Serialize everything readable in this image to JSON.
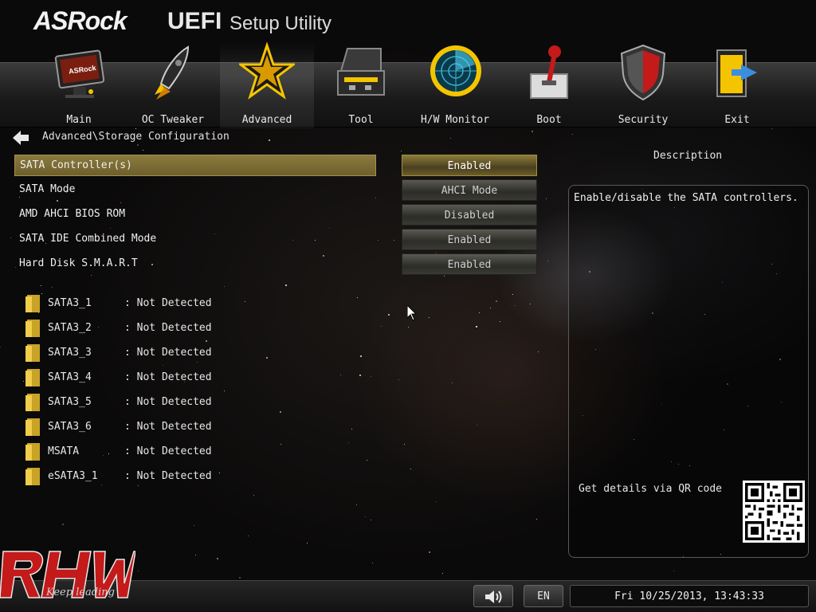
{
  "header": {
    "logo_text": "ASRock",
    "uefi_text": "UEFI",
    "setup_text": "Setup Utility"
  },
  "nav": {
    "active": "Advanced",
    "tabs": [
      {
        "label": "Main",
        "icon": "monitor-icon"
      },
      {
        "label": "OC Tweaker",
        "icon": "rocket-icon"
      },
      {
        "label": "Advanced",
        "icon": "star-icon"
      },
      {
        "label": "Tool",
        "icon": "toolbox-icon"
      },
      {
        "label": "H/W Monitor",
        "icon": "radar-icon"
      },
      {
        "label": "Boot",
        "icon": "joystick-icon"
      },
      {
        "label": "Security",
        "icon": "shield-icon"
      },
      {
        "label": "Exit",
        "icon": "exit-door-icon"
      }
    ]
  },
  "breadcrumb": "Advanced\\Storage Configuration",
  "settings": [
    {
      "label": "SATA Controller(s)",
      "value": "Enabled"
    },
    {
      "label": "SATA Mode",
      "value": "AHCI Mode"
    },
    {
      "label": "AMD AHCI BIOS ROM",
      "value": "Disabled"
    },
    {
      "label": "SATA IDE Combined Mode",
      "value": "Enabled"
    },
    {
      "label": "Hard Disk S.M.A.R.T",
      "value": "Enabled"
    }
  ],
  "drives": [
    {
      "port": "SATA3_1",
      "status": ": Not Detected"
    },
    {
      "port": "SATA3_2",
      "status": ": Not Detected"
    },
    {
      "port": "SATA3_3",
      "status": ": Not Detected"
    },
    {
      "port": "SATA3_4",
      "status": ": Not Detected"
    },
    {
      "port": "SATA3_5",
      "status": ": Not Detected"
    },
    {
      "port": "SATA3_6",
      "status": ": Not Detected"
    },
    {
      "port": "MSATA",
      "status": ": Not Detected"
    },
    {
      "port": "eSATA3_1",
      "status": ": Not Detected"
    }
  ],
  "description": {
    "title": "Description",
    "text": "Enable/disable the SATA controllers.",
    "qr_label": "Get details via QR code"
  },
  "footer": {
    "watermark_logo": "RHW",
    "watermark_tagline": "Keep leading",
    "language": "EN",
    "datetime": "Fri 10/25/2013, 13:43:33"
  },
  "colors": {
    "selected_row": "#7d6e34",
    "accent_gold": "#f5c400",
    "watermark_red": "#c41a1a"
  }
}
